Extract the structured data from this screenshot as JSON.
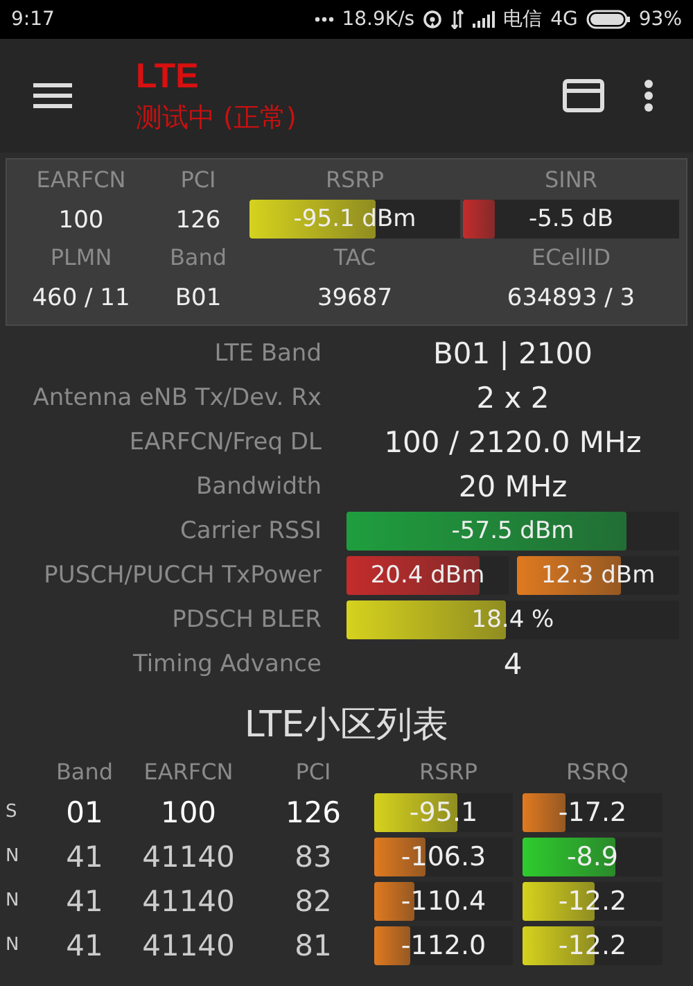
{
  "status_bar": {
    "time": "9:17",
    "network_speed": "18.9K/s",
    "carrier": "电信",
    "network_type": "4G",
    "battery": "93%"
  },
  "toolbar": {
    "title": "LTE",
    "subtitle": "测试中 (正常)"
  },
  "summary": {
    "cells": [
      {
        "label": "EARFCN",
        "kind": "text",
        "value": "100"
      },
      {
        "label": "PCI",
        "kind": "text",
        "value": "126"
      },
      {
        "label": "RSRP",
        "kind": "bar",
        "value": "-95.1 dBm",
        "level": 0.6,
        "color": "#d6d21e"
      },
      {
        "label": "SINR",
        "kind": "bar",
        "value": "-5.5 dB",
        "level": 0.15,
        "color": "#c42c2c"
      },
      {
        "label": "PLMN",
        "kind": "text",
        "value": "460 / 11"
      },
      {
        "label": "Band",
        "kind": "text",
        "value": "B01"
      },
      {
        "label": "TAC",
        "kind": "text",
        "value": "39687"
      },
      {
        "label": "ECellID",
        "kind": "text",
        "value": "634893 / 3"
      }
    ]
  },
  "details": [
    {
      "label": "LTE Band",
      "kind": "text",
      "value": "B01 | 2100"
    },
    {
      "label": "Antenna eNB Tx/Dev. Rx",
      "kind": "text",
      "value": "2 x 2"
    },
    {
      "label": "EARFCN/Freq DL",
      "kind": "text",
      "value": "100 / 2120.0 MHz"
    },
    {
      "label": "Bandwidth",
      "kind": "text",
      "value": "20 MHz"
    },
    {
      "label": "Carrier RSSI",
      "kind": "bars",
      "bars": [
        {
          "value": "-57.5 dBm",
          "level": 0.84,
          "color": "#1f9e3e"
        }
      ]
    },
    {
      "label": "PUSCH/PUCCH TxPower",
      "kind": "bars",
      "bars": [
        {
          "value": "20.4 dBm",
          "level": 0.82,
          "color": "#c42c2c"
        },
        {
          "value": "12.3 dBm",
          "level": 0.64,
          "color": "#e07a20"
        }
      ]
    },
    {
      "label": "PDSCH BLER",
      "kind": "bars",
      "bars": [
        {
          "value": "18.4 %",
          "level": 0.48,
          "color": "#d6d21e"
        }
      ]
    },
    {
      "label": "Timing Advance",
      "kind": "text",
      "value": "4"
    }
  ],
  "cell_list": {
    "title": "LTE小区列表",
    "columns": [
      "Band",
      "EARFCN",
      "PCI",
      "RSRP",
      "RSRQ"
    ],
    "rows": [
      {
        "type": "S",
        "serving": true,
        "band": "01",
        "earfcn": "100",
        "pci": "126",
        "rsrp": {
          "value": "-95.1",
          "level": 0.6,
          "color": "#d6d21e"
        },
        "rsrq": {
          "value": "-17.2",
          "level": 0.31,
          "color": "#e07a20"
        }
      },
      {
        "type": "N",
        "serving": false,
        "band": "41",
        "earfcn": "41140",
        "pci": "83",
        "rsrp": {
          "value": "-106.3",
          "level": 0.37,
          "color": "#e07a20"
        },
        "rsrq": {
          "value": "-8.9",
          "level": 0.66,
          "color": "#2ecc2e"
        }
      },
      {
        "type": "N",
        "serving": false,
        "band": "41",
        "earfcn": "41140",
        "pci": "82",
        "rsrp": {
          "value": "-110.4",
          "level": 0.29,
          "color": "#e07a20"
        },
        "rsrq": {
          "value": "-12.2",
          "level": 0.51,
          "color": "#d6d21e"
        }
      },
      {
        "type": "N",
        "serving": false,
        "band": "41",
        "earfcn": "41140",
        "pci": "81",
        "rsrp": {
          "value": "-112.0",
          "level": 0.26,
          "color": "#e07a20"
        },
        "rsrq": {
          "value": "-12.2",
          "level": 0.51,
          "color": "#d6d21e"
        }
      }
    ]
  }
}
